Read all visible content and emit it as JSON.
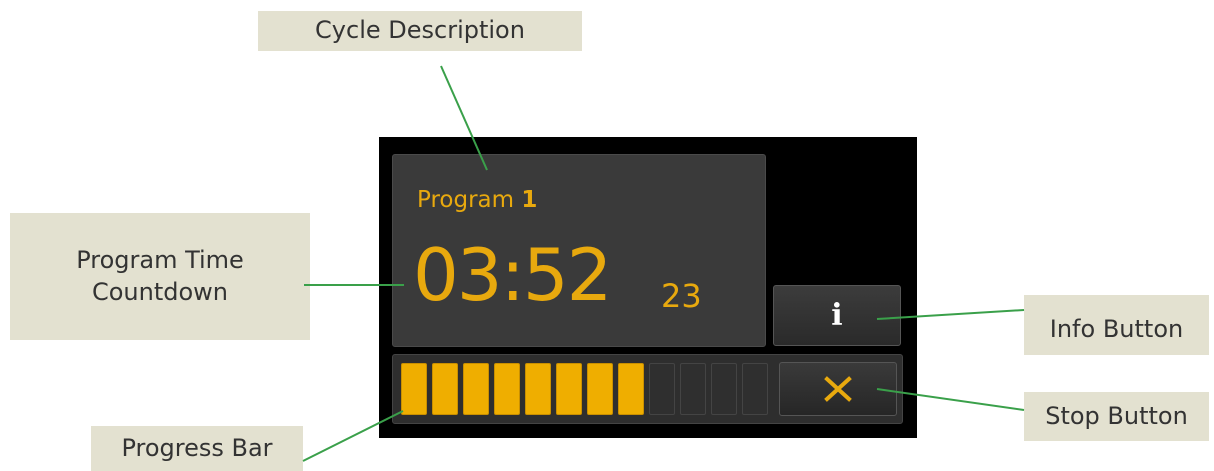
{
  "callouts": {
    "cycle_description": "Cycle Description",
    "program_time_line1": "Program Time",
    "program_time_line2": "Countdown",
    "info_button": "Info Button",
    "stop_button": "Stop Button",
    "progress_bar": "Progress Bar"
  },
  "screen": {
    "program_word": "Program",
    "program_number": "1",
    "time_main": "03:52",
    "time_seconds": "23",
    "info_icon": "info-icon",
    "stop_icon": "close-icon",
    "progress": {
      "filled_segments": 8,
      "total_segments": 12
    }
  },
  "colors": {
    "accent": "#e8a90e",
    "panel_bg": "#000000",
    "box_bg": "#3a3a3a",
    "callout_bg": "#e3e1d0",
    "leader_line": "#3aa04a"
  }
}
